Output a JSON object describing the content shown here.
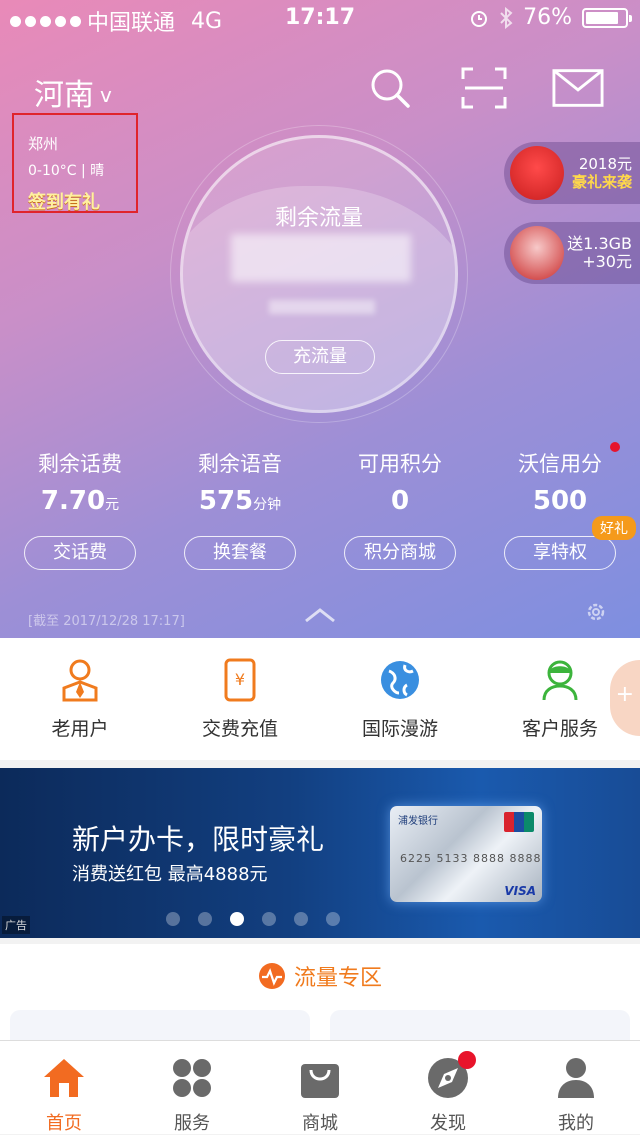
{
  "status_bar": {
    "carrier": "中国联通",
    "network": "4G",
    "time": "17:17",
    "battery": "76%"
  },
  "header": {
    "region": "河南",
    "region_chevron": "v"
  },
  "weather": {
    "city": "郑州",
    "temp": "0-10°C | 晴",
    "checkin_a": "签到",
    "checkin_b": "有礼"
  },
  "gauge": {
    "title": "剩余流量",
    "recharge_button": "充流量"
  },
  "promos": [
    {
      "line1": "2018元",
      "line2": "豪礼来袭"
    },
    {
      "line1": "送1.3GB",
      "line2": "+30元"
    }
  ],
  "stats": [
    {
      "label": "剩余话费",
      "value": "7.70",
      "unit": "元",
      "button": "交话费"
    },
    {
      "label": "剩余语音",
      "value": "575",
      "unit": "分钟",
      "button": "换套餐"
    },
    {
      "label": "可用积分",
      "value": "0",
      "unit": "",
      "button": "积分商城"
    },
    {
      "label": "沃信用分",
      "value": "500",
      "unit": "",
      "button": "享特权",
      "badge": "好礼"
    }
  ],
  "as_of": "[截至 2017/12/28 17:17]",
  "quick_menu": [
    {
      "label": "老用户",
      "icon": "old-user-icon"
    },
    {
      "label": "交费充值",
      "icon": "payment-phone-icon"
    },
    {
      "label": "国际漫游",
      "icon": "globe-icon"
    },
    {
      "label": "客户服务",
      "icon": "customer-service-icon"
    }
  ],
  "side_plus": "+",
  "banner": {
    "headline": "新户办卡，限时豪礼",
    "subline": "消费送红包 最高4888元",
    "ad_tag": "广告",
    "card_bank": "浦发银行",
    "card_number": "6225 5133 8888 8888",
    "card_brand": "VISA",
    "pages": 6,
    "active_page": 3
  },
  "flow_zone": {
    "title": "流量专区"
  },
  "tabs": [
    {
      "label": "首页",
      "icon": "home-icon",
      "active": true
    },
    {
      "label": "服务",
      "icon": "service-grid-icon",
      "active": false
    },
    {
      "label": "商城",
      "icon": "shopping-bag-icon",
      "active": false
    },
    {
      "label": "发现",
      "icon": "compass-icon",
      "active": false
    },
    {
      "label": "我的",
      "icon": "user-icon",
      "active": false
    }
  ],
  "colors": {
    "accent": "#f26b21",
    "highlight_box": "#e0242c",
    "badge_red": "#e6142d",
    "gold": "#ffd23a"
  }
}
